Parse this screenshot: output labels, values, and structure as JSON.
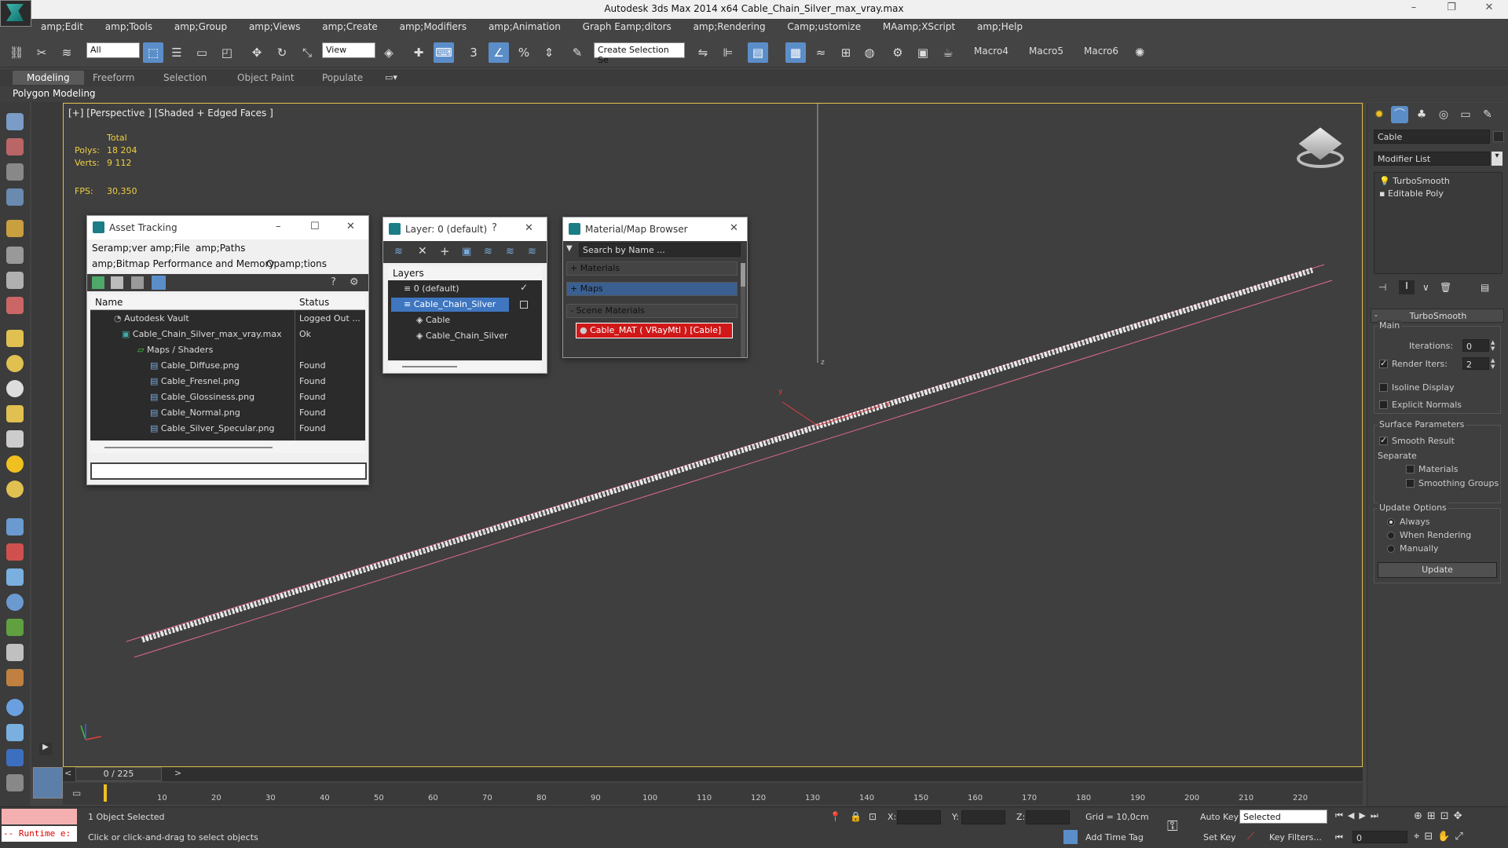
{
  "app": {
    "title": "Autodesk 3ds Max  2014 x64     Cable_Chain_Silver_max_vray.max"
  },
  "window_buttons": {
    "minimize": "–",
    "restore": "❐",
    "close": "✕"
  },
  "menu": [
    "amp;Edit",
    "amp;Tools",
    "amp;Group",
    "amp;Views",
    "amp;Create",
    "amp;Modifiers",
    "amp;Animation",
    "Graph Eamp;ditors",
    "amp;Rendering",
    "Camp;ustomize",
    "MAamp;XScript",
    "amp;Help"
  ],
  "toolbar": {
    "filter": "All",
    "refcoord": "View",
    "selection_set": "Create Selection Se",
    "macros": [
      "Macro4",
      "Macro5",
      "Macro6"
    ]
  },
  "ribbon": {
    "tabs": [
      "Modeling",
      "Freeform",
      "Selection",
      "Object Paint",
      "Populate"
    ],
    "active": "Modeling",
    "subpanel": "Polygon Modeling"
  },
  "viewport": {
    "label": "[+] [Perspective ] [Shaded + Edged Faces ]",
    "stats": {
      "total_label": "Total",
      "polys_label": "Polys:",
      "polys": "18 204",
      "verts_label": "Verts:",
      "verts": "9 112",
      "fps_label": "FPS:",
      "fps": "30,350"
    },
    "axis_x": "x",
    "axis_y": "y",
    "axis_z": "z"
  },
  "asset_tracking": {
    "title": "Asset Tracking",
    "menu": [
      "Seramp;ver",
      "amp;File",
      "amp;Paths",
      "amp;Bitmap Performance and Memory",
      "Opamp;tions"
    ],
    "columns": [
      "Name",
      "Status"
    ],
    "rows": [
      {
        "name": "Autodesk Vault",
        "status": "Logged Out ..."
      },
      {
        "name": "Cable_Chain_Silver_max_vray.max",
        "status": "Ok"
      },
      {
        "name": "Maps / Shaders",
        "status": ""
      },
      {
        "name": "Cable_Diffuse.png",
        "status": "Found"
      },
      {
        "name": "Cable_Fresnel.png",
        "status": "Found"
      },
      {
        "name": "Cable_Glossiness.png",
        "status": "Found"
      },
      {
        "name": "Cable_Normal.png",
        "status": "Found"
      },
      {
        "name": "Cable_Silver_Specular.png",
        "status": "Found"
      }
    ]
  },
  "layer_window": {
    "title": "Layer: 0 (default)",
    "help": "?",
    "header": "Layers",
    "items": [
      "0 (default)",
      "Cable_Chain_Silver",
      "Cable",
      "Cable_Chain_Silver"
    ]
  },
  "material_browser": {
    "title": "Material/Map Browser",
    "search_placeholder": "Search by Name ...",
    "sections": [
      "+ Materials",
      "+ Maps",
      "- Scene Materials"
    ],
    "scene_material": "Cable_MAT ( VRayMtl ) [Cable]"
  },
  "command_panel": {
    "object_name": "Cable",
    "modifier_list": "Modifier List",
    "stack": [
      "TurboSmooth",
      "Editable Poly"
    ],
    "turbosmooth": {
      "title": "TurboSmooth",
      "main": "Main",
      "iterations_label": "Iterations:",
      "iterations": "0",
      "render_iters_label": "Render Iters:",
      "render_iters": "2",
      "isoline": "Isoline Display",
      "explicit_normals": "Explicit Normals",
      "surface_params": "Surface Parameters",
      "smooth_result": "Smooth Result",
      "separate": "Separate",
      "materials": "Materials",
      "smoothing_groups": "Smoothing Groups",
      "update_options": "Update Options",
      "always": "Always",
      "when_rendering": "When Rendering",
      "manually": "Manually",
      "update_button": "Update"
    }
  },
  "timeline": {
    "frame": "0 / 225",
    "ticks": [
      "10",
      "20",
      "30",
      "40",
      "50",
      "60",
      "70",
      "80",
      "90",
      "100",
      "110",
      "120",
      "130",
      "140",
      "150",
      "160",
      "170",
      "180",
      "190",
      "200",
      "210",
      "220"
    ]
  },
  "status": {
    "maxscript": "-- Runtime e:",
    "selected": "1 Object Selected",
    "hint": "Click or click-and-drag to select objects",
    "x_label": "X:",
    "y_label": "Y:",
    "z_label": "Z:",
    "grid": "Grid = 10,0cm",
    "add_time_tag": "Add Time Tag",
    "auto_key": "Auto Key",
    "set_key": "Set Key",
    "key_mode": "Selected",
    "key_filters": "Key Filters...",
    "frame_field": "0"
  }
}
